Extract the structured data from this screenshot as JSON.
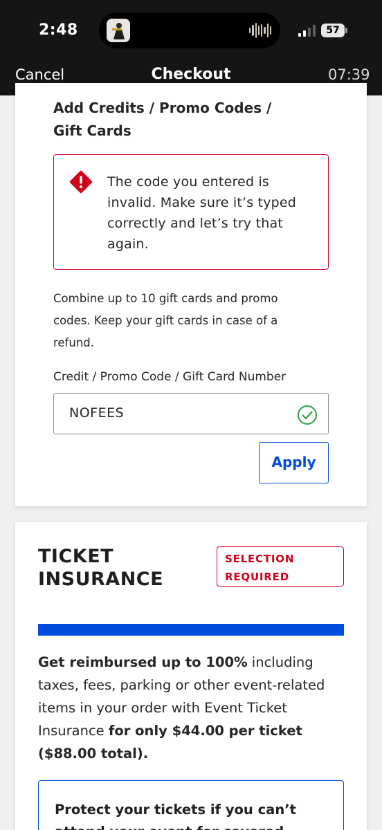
{
  "status_bar": {
    "time": "2:48",
    "battery": "57"
  },
  "nav": {
    "cancel_label": "Cancel",
    "title": "Checkout",
    "timer": "07:39"
  },
  "promo": {
    "title": "Add Credits / Promo Codes / Gift Cards",
    "error_message": "The code you entered is invalid. Make sure it’s typed correctly and let’s try that again.",
    "description": "Combine up to 10 gift cards and promo codes. Keep your gift cards in case of a refund.",
    "field_label": "Credit / Promo Code / Gift Card Number",
    "code_value": "NOFEES",
    "apply_label": "Apply"
  },
  "insurance": {
    "title": "TICKET INSURANCE",
    "badge": "SELECTION REQUIRED",
    "progress_fraction": 1.0,
    "desc_bold_1": "Get reimbursed up to 100%",
    "desc_text_1": " including taxes, fees, parking or other event-related items in your order with Event Ticket Insurance ",
    "desc_bold_2": "for only $44.00 per ticket ($88.00 total).",
    "protect_text": "Protect your tickets if you can’t attend your event for covered reasons like:"
  },
  "colors": {
    "error": "#d0021b",
    "accent": "#024ddf",
    "success": "#2e9e44",
    "header_bg": "#151515"
  },
  "icons": {
    "alert": "warning-diamond-icon",
    "valid": "check-circle-icon"
  }
}
